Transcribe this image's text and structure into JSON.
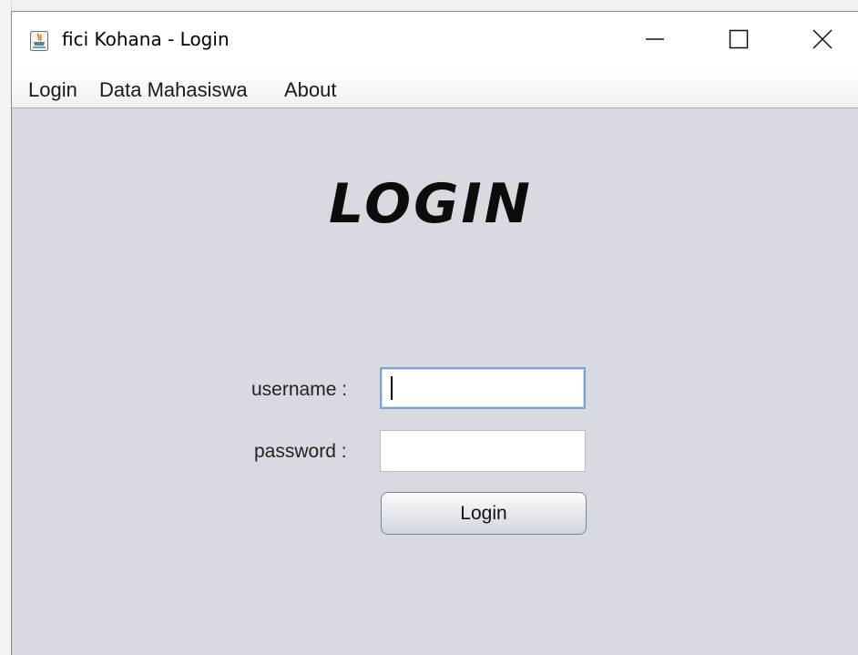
{
  "window": {
    "title": "fici Kohana - Login",
    "icon": "java-icon",
    "controls": [
      "minimize-icon",
      "maximize-icon",
      "close-icon"
    ]
  },
  "menu": {
    "items": [
      "Login",
      "Data Mahasiswa",
      "About"
    ]
  },
  "form": {
    "heading": "LOGIN",
    "username_label": "username :",
    "username_value": "",
    "password_label": "password :",
    "password_value": "",
    "submit_label": "Login"
  },
  "colors": {
    "content_bg": "#d8dae1",
    "focus_border": "#7aa4cc"
  }
}
